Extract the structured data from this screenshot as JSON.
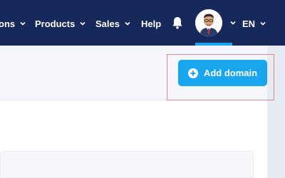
{
  "header": {
    "nav_items": [
      {
        "label": "ons"
      },
      {
        "label": "Products"
      },
      {
        "label": "Sales"
      },
      {
        "label": "Help"
      }
    ],
    "language": "EN",
    "notifications_icon": "bell-icon",
    "avatar_icon": "user-avatar"
  },
  "main": {
    "add_domain_label": "Add domain",
    "add_domain_icon": "plus-circle-icon"
  },
  "colors": {
    "header_bg": "#17285a",
    "accent": "#1aa5ef",
    "highlight_border": "#e1888a"
  }
}
